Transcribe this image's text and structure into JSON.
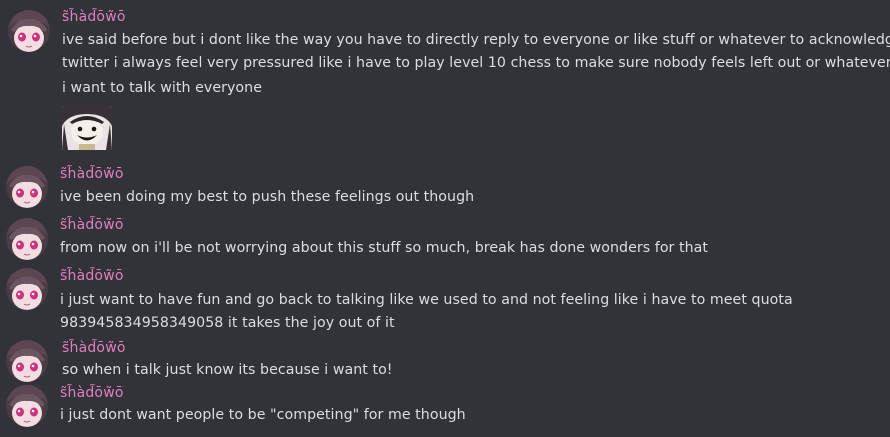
{
  "messages": [
    {
      "username": "s̃h̃àd̃ōw̃ō",
      "lines": [
        "ive said before but i dont like the way you have to directly reply to everyone or like stuff or whatever to acknowledge on",
        "twitter i always feel very pressured like i have to play level 10 chess to make sure nobody feels left out or whatever",
        "i want to talk with everyone"
      ],
      "has_sticker": true
    },
    {
      "username": "s̃h̃àd̃ōw̃ō",
      "lines": [
        "ive been doing my best to push these feelings out though"
      ]
    },
    {
      "username": "s̃h̃àd̃ōw̃ō",
      "lines": [
        "from now on i'll be not worrying about this stuff so much, break has done wonders for that"
      ]
    },
    {
      "username": "s̃h̃àd̃ōw̃ō",
      "lines": [
        "i just want to have fun and go back to talking like we used to and not feeling like i have to meet quota",
        "983945834958349058 it takes the joy out of it"
      ]
    },
    {
      "username": "s̃h̃àd̃ōw̃ō",
      "lines": [
        "so when i talk just know its because i want to!"
      ]
    },
    {
      "username": "s̃h̃àd̃ōw̃ō",
      "lines": [
        "i just dont want people to be \"competing\" for me though"
      ]
    }
  ],
  "colors": {
    "background": "#313338",
    "username": "#e07fc0",
    "text": "#dbdee1"
  },
  "icons": {
    "avatar": "anime-girl-avatar",
    "sticker": "smiling-face-sticker"
  }
}
